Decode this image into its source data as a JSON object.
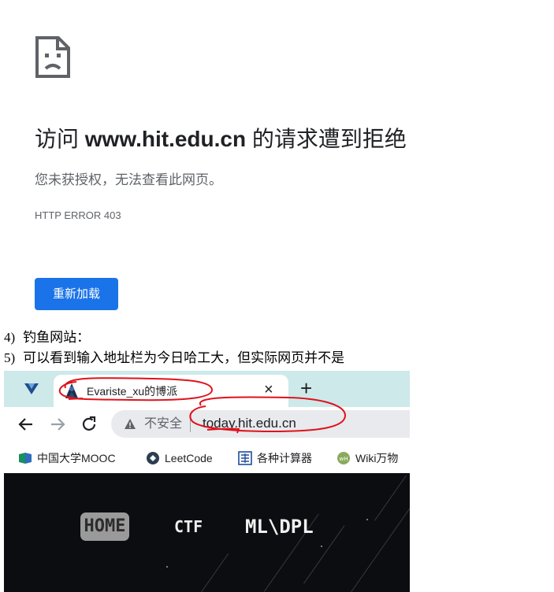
{
  "error_page": {
    "title_prefix": "访问 ",
    "title_host": "www.hit.edu.cn",
    "title_suffix": " 的请求遭到拒绝",
    "subtitle": "您未获授权，无法查看此网页。",
    "error_code": "HTTP ERROR 403",
    "reload_button": "重新加载"
  },
  "notes": [
    {
      "num": "4)",
      "text": "钓鱼网站："
    },
    {
      "num": "5)",
      "text": "可以看到输入地址栏为今日哈工大，但实际网页并不是"
    }
  ],
  "browser": {
    "tab": {
      "title": "Evariste_xu的博派",
      "close": "×"
    },
    "new_tab": "+",
    "security_label": "不安全",
    "url": "today.hit.edu.cn",
    "bookmarks": [
      {
        "label": "中国大学MOOC",
        "icon": "mooc-icon"
      },
      {
        "label": "LeetCode",
        "icon": "leetcode-icon"
      },
      {
        "label": "各种计算器",
        "icon": "calculator-icon"
      },
      {
        "label": "Wiki万物",
        "icon": "wiki-icon"
      }
    ],
    "annotation_color": "#e0121b"
  },
  "site_menu": {
    "home": "HOME",
    "ctf": "CTF",
    "ml": "ML\\DPL"
  }
}
